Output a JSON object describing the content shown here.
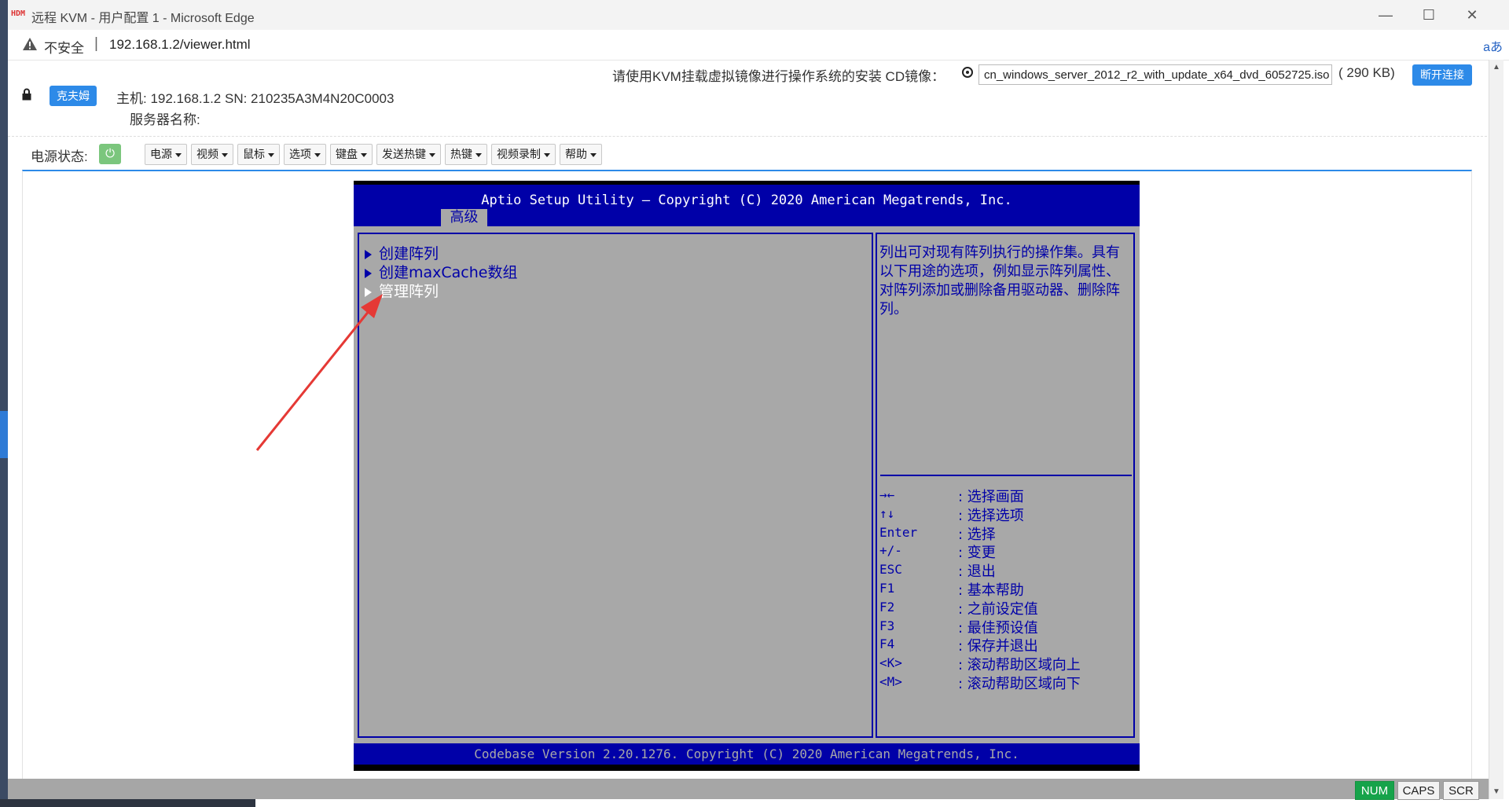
{
  "window": {
    "app_icon_text": "HDM",
    "title": "远程 KVM - 用户配置 1 - Microsoft Edge",
    "minimize": "—",
    "maximize": "☐",
    "close": "✕"
  },
  "address_bar": {
    "security_label": "不安全",
    "separator": "|",
    "url": "192.168.1.2/viewer.html",
    "read_aloud": "aあ"
  },
  "header": {
    "user_button": "克夫姆",
    "host_line": "主机:  192.168.1.2 SN:  210235A3M4N20C0003",
    "server_name_label": "服务器名称:",
    "cd_hint": "请使用KVM挂载虚拟镜像进行操作系统的安装  CD镜像：",
    "cd_file": "cn_windows_server_2012_r2_with_update_x64_dvd_6052725.iso",
    "cd_size": "( 290 KB)",
    "disconnect_button": "断开连接"
  },
  "toolbar": {
    "power_label": "电源状态:",
    "power_icon": "⏻",
    "menus": [
      "电源",
      "视频",
      "鼠标",
      "选项",
      "键盘",
      "发送热键",
      "热键",
      "视频录制",
      "帮助"
    ]
  },
  "bios": {
    "title": "Aptio Setup Utility – Copyright (C) 2020 American Megatrends, Inc.",
    "tab": "高级",
    "items": [
      {
        "label": "创建阵列",
        "selected": false
      },
      {
        "label": "创建maxCache数组",
        "selected": false
      },
      {
        "label": "管理阵列",
        "selected": true
      }
    ],
    "help_text": "列出可对现有阵列执行的操作集。具有以下用途的选项，例如显示阵列属性、对阵列添加或删除备用驱动器、删除阵列。",
    "keys": [
      {
        "key": "→←",
        "desc": ":  选择画面"
      },
      {
        "key": "↑↓",
        "desc": ":  选择选项"
      },
      {
        "key": "Enter",
        "desc": ":  选择"
      },
      {
        "key": "+/-",
        "desc": ":  变更"
      },
      {
        "key": "ESC",
        "desc": ":  退出"
      },
      {
        "key": "F1",
        "desc": ":  基本帮助"
      },
      {
        "key": "F2",
        "desc": ":  之前设定值"
      },
      {
        "key": "F3",
        "desc": ":  最佳预设值"
      },
      {
        "key": "F4",
        "desc": ":  保存并退出"
      },
      {
        "key": "<K>",
        "desc": ":  滚动帮助区域向上"
      },
      {
        "key": "<M>",
        "desc": ":  滚动帮助区域向下"
      }
    ],
    "footer": "Codebase Version 2.20.1276. Copyright (C) 2020 American Megatrends, Inc."
  },
  "status_indicators": {
    "num": "NUM",
    "caps": "CAPS",
    "scr": "SCR"
  },
  "colors": {
    "bios_blue": "#0000a8",
    "bios_gray": "#a8a8a8",
    "accent_blue": "#2d8ae8",
    "num_green": "#16a34a",
    "annotation_red": "#e53935"
  }
}
